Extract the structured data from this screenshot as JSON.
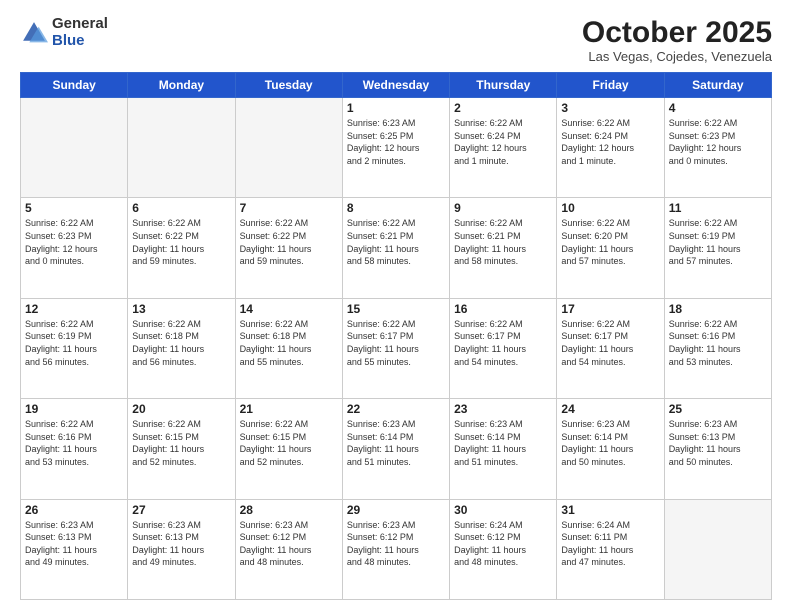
{
  "logo": {
    "general": "General",
    "blue": "Blue"
  },
  "header": {
    "month": "October 2025",
    "location": "Las Vegas, Cojedes, Venezuela"
  },
  "weekdays": [
    "Sunday",
    "Monday",
    "Tuesday",
    "Wednesday",
    "Thursday",
    "Friday",
    "Saturday"
  ],
  "weeks": [
    [
      {
        "day": "",
        "info": ""
      },
      {
        "day": "",
        "info": ""
      },
      {
        "day": "",
        "info": ""
      },
      {
        "day": "1",
        "info": "Sunrise: 6:23 AM\nSunset: 6:25 PM\nDaylight: 12 hours\nand 2 minutes."
      },
      {
        "day": "2",
        "info": "Sunrise: 6:22 AM\nSunset: 6:24 PM\nDaylight: 12 hours\nand 1 minute."
      },
      {
        "day": "3",
        "info": "Sunrise: 6:22 AM\nSunset: 6:24 PM\nDaylight: 12 hours\nand 1 minute."
      },
      {
        "day": "4",
        "info": "Sunrise: 6:22 AM\nSunset: 6:23 PM\nDaylight: 12 hours\nand 0 minutes."
      }
    ],
    [
      {
        "day": "5",
        "info": "Sunrise: 6:22 AM\nSunset: 6:23 PM\nDaylight: 12 hours\nand 0 minutes."
      },
      {
        "day": "6",
        "info": "Sunrise: 6:22 AM\nSunset: 6:22 PM\nDaylight: 11 hours\nand 59 minutes."
      },
      {
        "day": "7",
        "info": "Sunrise: 6:22 AM\nSunset: 6:22 PM\nDaylight: 11 hours\nand 59 minutes."
      },
      {
        "day": "8",
        "info": "Sunrise: 6:22 AM\nSunset: 6:21 PM\nDaylight: 11 hours\nand 58 minutes."
      },
      {
        "day": "9",
        "info": "Sunrise: 6:22 AM\nSunset: 6:21 PM\nDaylight: 11 hours\nand 58 minutes."
      },
      {
        "day": "10",
        "info": "Sunrise: 6:22 AM\nSunset: 6:20 PM\nDaylight: 11 hours\nand 57 minutes."
      },
      {
        "day": "11",
        "info": "Sunrise: 6:22 AM\nSunset: 6:19 PM\nDaylight: 11 hours\nand 57 minutes."
      }
    ],
    [
      {
        "day": "12",
        "info": "Sunrise: 6:22 AM\nSunset: 6:19 PM\nDaylight: 11 hours\nand 56 minutes."
      },
      {
        "day": "13",
        "info": "Sunrise: 6:22 AM\nSunset: 6:18 PM\nDaylight: 11 hours\nand 56 minutes."
      },
      {
        "day": "14",
        "info": "Sunrise: 6:22 AM\nSunset: 6:18 PM\nDaylight: 11 hours\nand 55 minutes."
      },
      {
        "day": "15",
        "info": "Sunrise: 6:22 AM\nSunset: 6:17 PM\nDaylight: 11 hours\nand 55 minutes."
      },
      {
        "day": "16",
        "info": "Sunrise: 6:22 AM\nSunset: 6:17 PM\nDaylight: 11 hours\nand 54 minutes."
      },
      {
        "day": "17",
        "info": "Sunrise: 6:22 AM\nSunset: 6:17 PM\nDaylight: 11 hours\nand 54 minutes."
      },
      {
        "day": "18",
        "info": "Sunrise: 6:22 AM\nSunset: 6:16 PM\nDaylight: 11 hours\nand 53 minutes."
      }
    ],
    [
      {
        "day": "19",
        "info": "Sunrise: 6:22 AM\nSunset: 6:16 PM\nDaylight: 11 hours\nand 53 minutes."
      },
      {
        "day": "20",
        "info": "Sunrise: 6:22 AM\nSunset: 6:15 PM\nDaylight: 11 hours\nand 52 minutes."
      },
      {
        "day": "21",
        "info": "Sunrise: 6:22 AM\nSunset: 6:15 PM\nDaylight: 11 hours\nand 52 minutes."
      },
      {
        "day": "22",
        "info": "Sunrise: 6:23 AM\nSunset: 6:14 PM\nDaylight: 11 hours\nand 51 minutes."
      },
      {
        "day": "23",
        "info": "Sunrise: 6:23 AM\nSunset: 6:14 PM\nDaylight: 11 hours\nand 51 minutes."
      },
      {
        "day": "24",
        "info": "Sunrise: 6:23 AM\nSunset: 6:14 PM\nDaylight: 11 hours\nand 50 minutes."
      },
      {
        "day": "25",
        "info": "Sunrise: 6:23 AM\nSunset: 6:13 PM\nDaylight: 11 hours\nand 50 minutes."
      }
    ],
    [
      {
        "day": "26",
        "info": "Sunrise: 6:23 AM\nSunset: 6:13 PM\nDaylight: 11 hours\nand 49 minutes."
      },
      {
        "day": "27",
        "info": "Sunrise: 6:23 AM\nSunset: 6:13 PM\nDaylight: 11 hours\nand 49 minutes."
      },
      {
        "day": "28",
        "info": "Sunrise: 6:23 AM\nSunset: 6:12 PM\nDaylight: 11 hours\nand 48 minutes."
      },
      {
        "day": "29",
        "info": "Sunrise: 6:23 AM\nSunset: 6:12 PM\nDaylight: 11 hours\nand 48 minutes."
      },
      {
        "day": "30",
        "info": "Sunrise: 6:24 AM\nSunset: 6:12 PM\nDaylight: 11 hours\nand 48 minutes."
      },
      {
        "day": "31",
        "info": "Sunrise: 6:24 AM\nSunset: 6:11 PM\nDaylight: 11 hours\nand 47 minutes."
      },
      {
        "day": "",
        "info": ""
      }
    ]
  ]
}
